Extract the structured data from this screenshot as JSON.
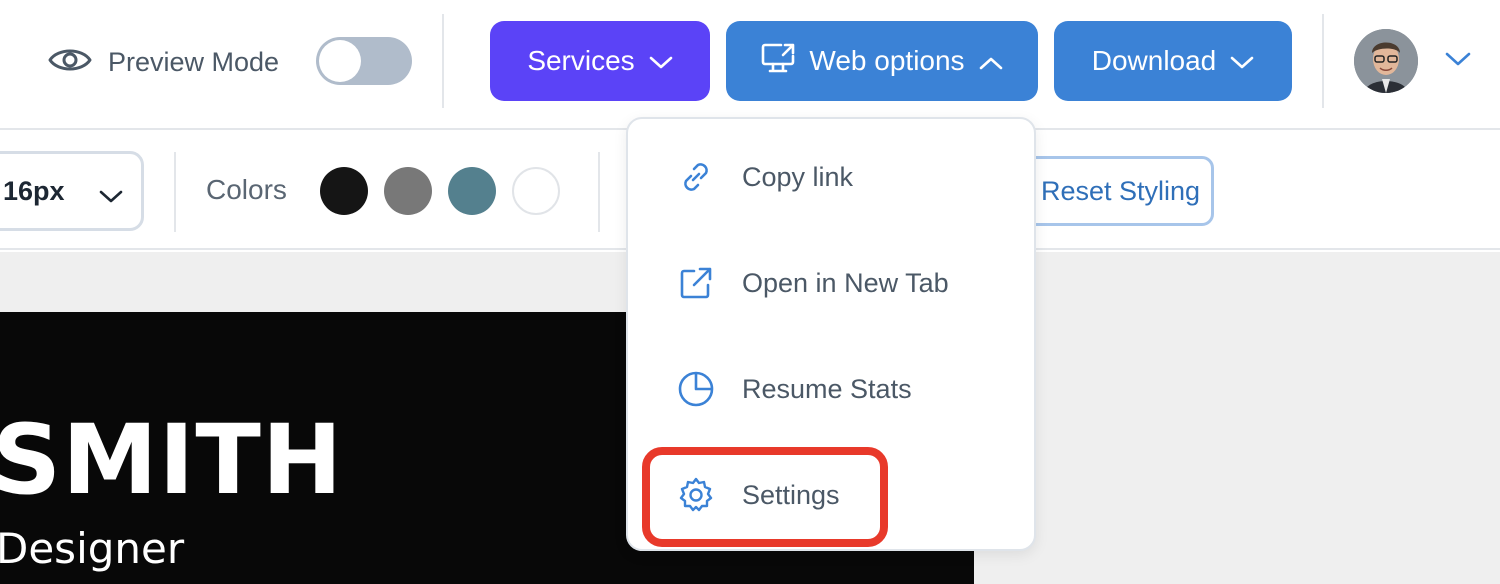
{
  "header": {
    "preview_label": "Preview Mode",
    "preview_enabled": false,
    "services_label": "Services",
    "web_options_label": "Web options",
    "download_label": "Download"
  },
  "toolbar": {
    "font_size_value": "16px",
    "colors_label": "Colors",
    "color_swatches": [
      "#151515",
      "#787878",
      "#54808e",
      "#ffffff"
    ],
    "reset_label": "Reset Styling"
  },
  "resume": {
    "name": "SMITH",
    "subtitle": "Designer"
  },
  "web_options_menu": {
    "items": [
      {
        "label": "Copy link",
        "icon": "link-icon"
      },
      {
        "label": "Open in New Tab",
        "icon": "external-link-icon"
      },
      {
        "label": "Resume Stats",
        "icon": "pie-chart-icon"
      },
      {
        "label": "Settings",
        "icon": "gear-icon"
      }
    ],
    "highlighted_item": "Settings"
  },
  "colors": {
    "services_bg": "#5b43f7",
    "primary_bg": "#3b82d6",
    "highlight_border": "#e8392a"
  }
}
